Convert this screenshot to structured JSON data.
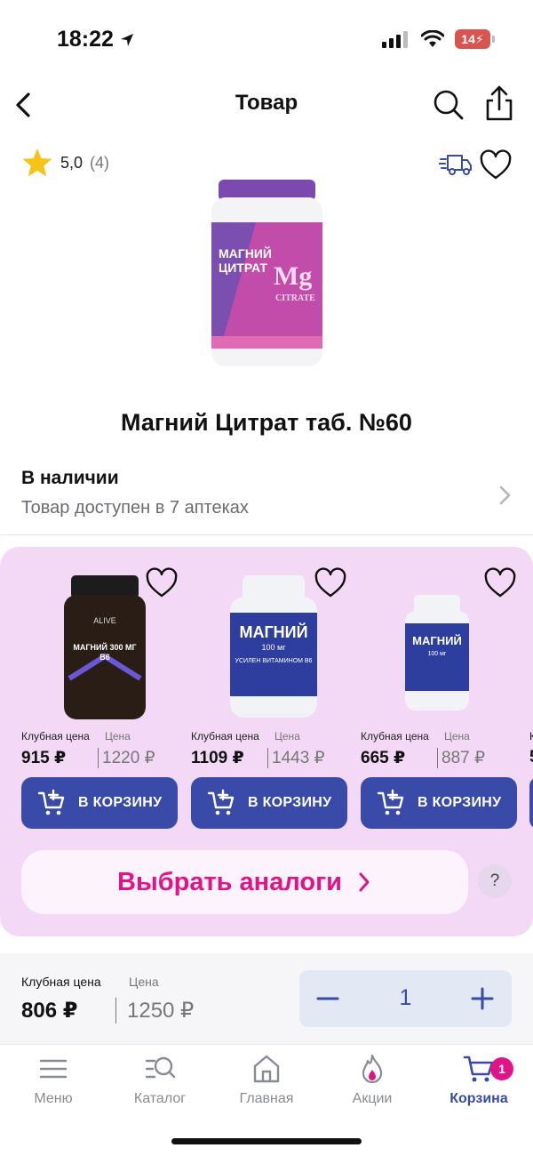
{
  "status_bar": {
    "time": "18:22",
    "battery": "14",
    "icons": [
      "location-arrow-icon",
      "signal-icon",
      "wifi-icon",
      "battery-charging-icon"
    ]
  },
  "header": {
    "title": "Товар",
    "back_icon": "chevron-left-icon",
    "search_icon": "search-icon",
    "share_icon": "share-icon"
  },
  "product": {
    "rating": "5,0",
    "reviews": "(4)",
    "title": "Магний Цитрат таб. №60",
    "image_label": "magnesium-citrate-bottle"
  },
  "availability": {
    "title": "В наличии",
    "subtitle": "Товар доступен в 7 аптеках"
  },
  "analogs": {
    "cards": [
      {
        "image_label": "magnesium-300-bottle",
        "club_label": "Клубная цена",
        "regular_label": "Цена",
        "club_price": "915 ₽",
        "regular_price": "1220 ₽",
        "button_label": "В КОРЗИНУ"
      },
      {
        "image_label": "magnesium-100-bottle",
        "club_label": "Клубная цена",
        "regular_label": "Цена",
        "club_price": "1109 ₽",
        "regular_price": "1443 ₽",
        "button_label": "В КОРЗИНУ"
      },
      {
        "image_label": "magnesium-100-small-bottle",
        "club_label": "Клубная цена",
        "regular_label": "Цена",
        "club_price": "665 ₽",
        "regular_price": "887 ₽",
        "button_label": "В КОРЗИНУ"
      }
    ],
    "partial_price_label": "К",
    "partial_price": "5",
    "choose_label": "Выбрать аналоги",
    "help_label": "?"
  },
  "buy_bar": {
    "club_label": "Клубная цена",
    "regular_label": "Цена",
    "club_price": "806 ₽",
    "regular_price": "1250 ₽",
    "quantity": "1"
  },
  "tab_bar": {
    "tabs": [
      {
        "label": "Меню",
        "icon": "menu-icon"
      },
      {
        "label": "Каталог",
        "icon": "catalog-icon"
      },
      {
        "label": "Главная",
        "icon": "home-icon"
      },
      {
        "label": "Акции",
        "icon": "promo-flame-icon"
      },
      {
        "label": "Корзина",
        "icon": "cart-icon"
      }
    ],
    "cart_badge": "1"
  },
  "colors": {
    "accent": "#3a4aa8",
    "pink": "#e0148a",
    "analogs_bg": "#f3d9f6"
  }
}
